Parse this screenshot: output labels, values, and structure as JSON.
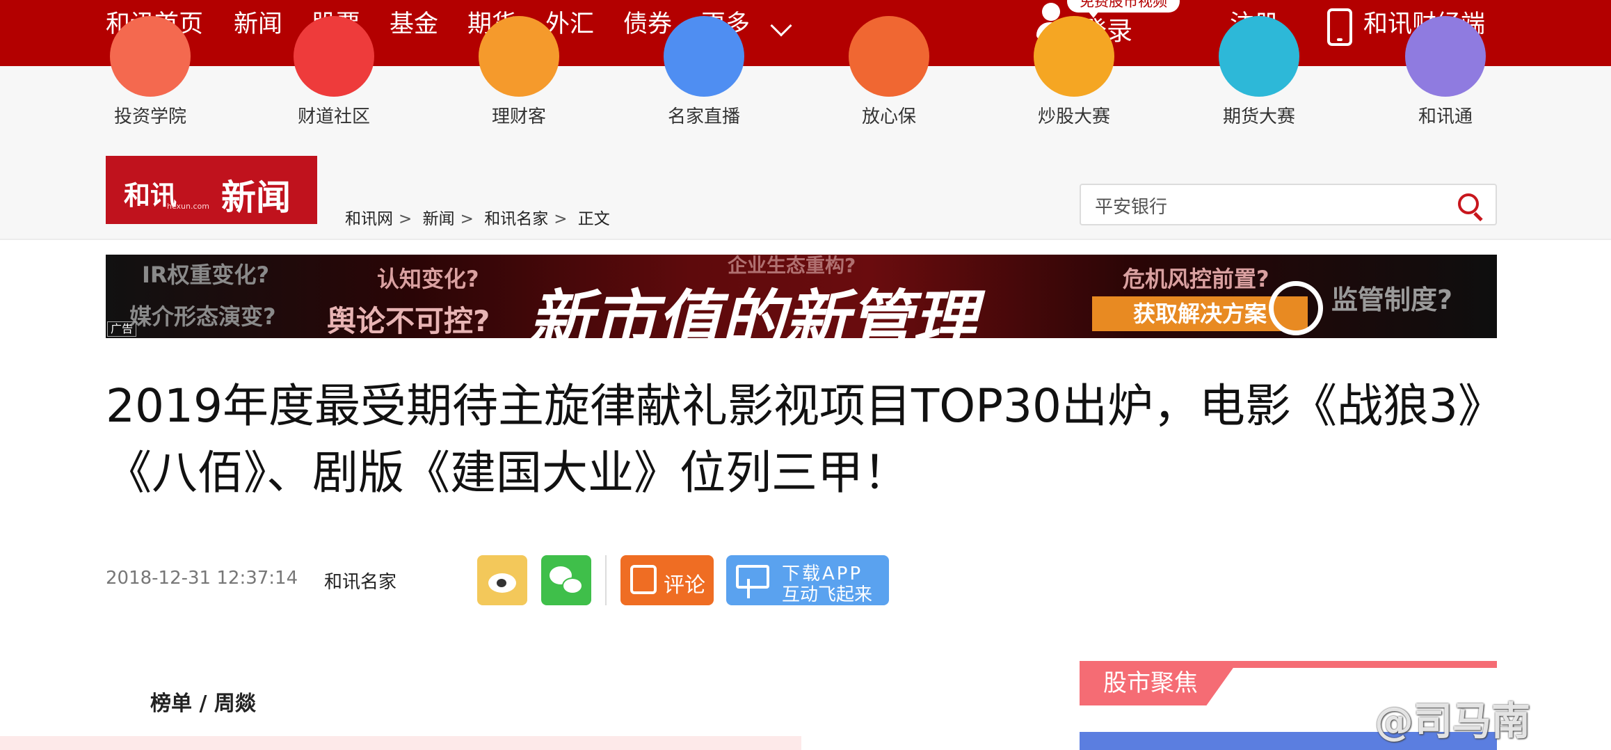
{
  "topnav": {
    "items": [
      "和讯首页",
      "新闻",
      "股票",
      "基金",
      "期货",
      "外汇",
      "债券",
      "更多"
    ],
    "login_tip": "免费股市视频",
    "login": "登录",
    "register": "注册",
    "app": "和讯财经端"
  },
  "quicklinks": [
    {
      "label": "投资学院",
      "color": "#f4694f"
    },
    {
      "label": "财道社区",
      "color": "#ee3b3b"
    },
    {
      "label": "理财客",
      "color": "#f59a2c"
    },
    {
      "label": "名家直播",
      "color": "#4f8ef2"
    },
    {
      "label": "放心保",
      "color": "#f06732"
    },
    {
      "label": "炒股大赛",
      "color": "#f5a623"
    },
    {
      "label": "期货大赛",
      "color": "#2db8d8"
    },
    {
      "label": "和讯通",
      "color": "#8f7be0"
    }
  ],
  "logo": {
    "brand": "和讯",
    "sub": "hexun.com",
    "section": "新闻"
  },
  "breadcrumb": [
    "和讯网",
    "新闻",
    "和讯名家",
    "正文"
  ],
  "search": {
    "value": "平安银行"
  },
  "banner": {
    "t1": "IR权重变化?",
    "t2": "媒介形态演变?",
    "t3": "认知变化?",
    "t4": "舆论不可控?",
    "t5": "企业生态重构?",
    "main": "新市值的新管理",
    "t6": "危机风控前置?",
    "cta": "获取解决方案",
    "t7": "监管制度?",
    "ad": "广告"
  },
  "article": {
    "title": "2019年度最受期待主旋律献礼影视项目TOP30出炉，电影《战狼3》《八佰》、剧版《建国大业》位列三甲！",
    "datetime": "2018-12-31 12:37:14",
    "source": "和讯名家",
    "section_header": "榜单 / 周燚"
  },
  "actions": {
    "comment": "评论",
    "download_line1": "下载APP",
    "download_line2": "互动飞起来"
  },
  "sidebar": {
    "focus_title": "股市聚焦"
  },
  "watermark": "@司马南"
}
